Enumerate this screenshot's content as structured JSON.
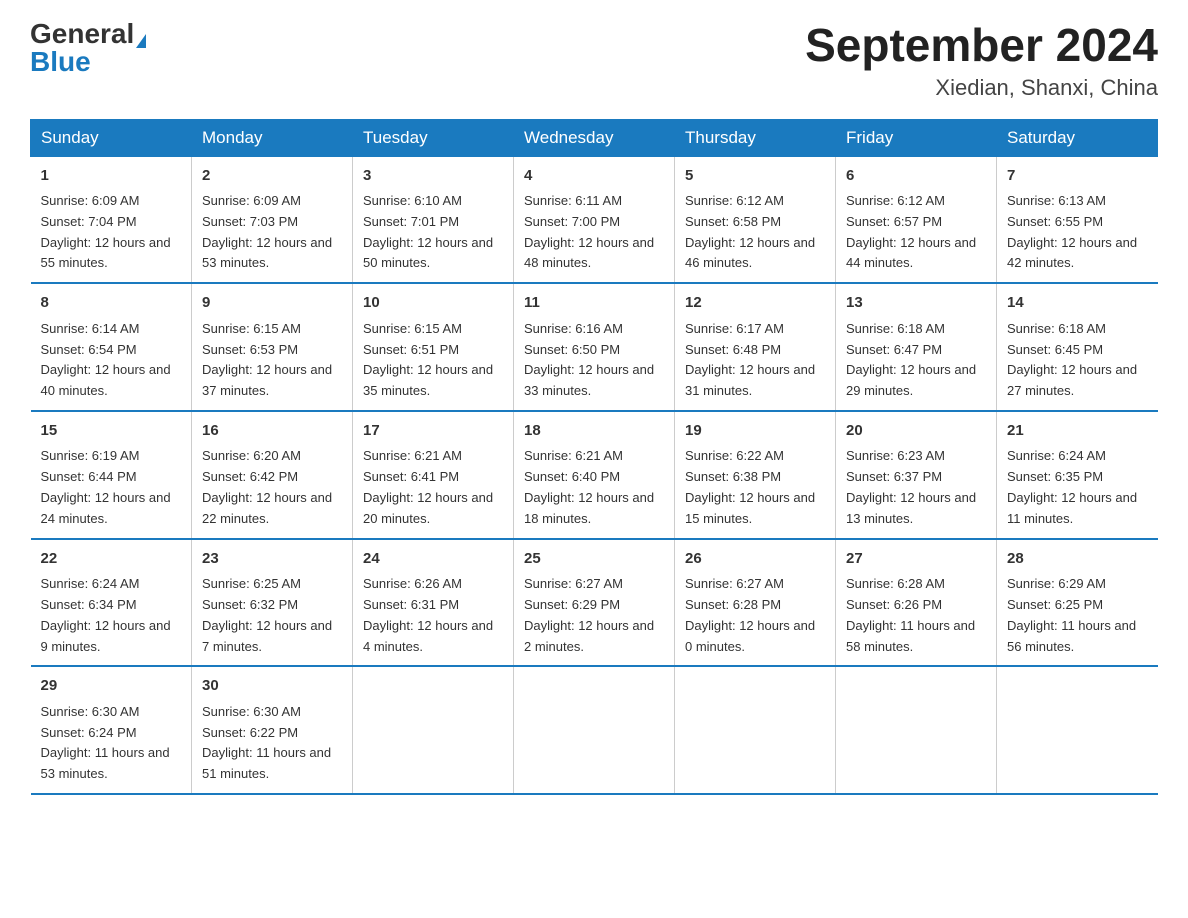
{
  "header": {
    "logo_general": "General",
    "logo_blue": "Blue",
    "month_year": "September 2024",
    "location": "Xiedian, Shanxi, China"
  },
  "weekdays": [
    "Sunday",
    "Monday",
    "Tuesday",
    "Wednesday",
    "Thursday",
    "Friday",
    "Saturday"
  ],
  "weeks": [
    [
      {
        "day": "1",
        "sunrise": "6:09 AM",
        "sunset": "7:04 PM",
        "daylight": "12 hours and 55 minutes."
      },
      {
        "day": "2",
        "sunrise": "6:09 AM",
        "sunset": "7:03 PM",
        "daylight": "12 hours and 53 minutes."
      },
      {
        "day": "3",
        "sunrise": "6:10 AM",
        "sunset": "7:01 PM",
        "daylight": "12 hours and 50 minutes."
      },
      {
        "day": "4",
        "sunrise": "6:11 AM",
        "sunset": "7:00 PM",
        "daylight": "12 hours and 48 minutes."
      },
      {
        "day": "5",
        "sunrise": "6:12 AM",
        "sunset": "6:58 PM",
        "daylight": "12 hours and 46 minutes."
      },
      {
        "day": "6",
        "sunrise": "6:12 AM",
        "sunset": "6:57 PM",
        "daylight": "12 hours and 44 minutes."
      },
      {
        "day": "7",
        "sunrise": "6:13 AM",
        "sunset": "6:55 PM",
        "daylight": "12 hours and 42 minutes."
      }
    ],
    [
      {
        "day": "8",
        "sunrise": "6:14 AM",
        "sunset": "6:54 PM",
        "daylight": "12 hours and 40 minutes."
      },
      {
        "day": "9",
        "sunrise": "6:15 AM",
        "sunset": "6:53 PM",
        "daylight": "12 hours and 37 minutes."
      },
      {
        "day": "10",
        "sunrise": "6:15 AM",
        "sunset": "6:51 PM",
        "daylight": "12 hours and 35 minutes."
      },
      {
        "day": "11",
        "sunrise": "6:16 AM",
        "sunset": "6:50 PM",
        "daylight": "12 hours and 33 minutes."
      },
      {
        "day": "12",
        "sunrise": "6:17 AM",
        "sunset": "6:48 PM",
        "daylight": "12 hours and 31 minutes."
      },
      {
        "day": "13",
        "sunrise": "6:18 AM",
        "sunset": "6:47 PM",
        "daylight": "12 hours and 29 minutes."
      },
      {
        "day": "14",
        "sunrise": "6:18 AM",
        "sunset": "6:45 PM",
        "daylight": "12 hours and 27 minutes."
      }
    ],
    [
      {
        "day": "15",
        "sunrise": "6:19 AM",
        "sunset": "6:44 PM",
        "daylight": "12 hours and 24 minutes."
      },
      {
        "day": "16",
        "sunrise": "6:20 AM",
        "sunset": "6:42 PM",
        "daylight": "12 hours and 22 minutes."
      },
      {
        "day": "17",
        "sunrise": "6:21 AM",
        "sunset": "6:41 PM",
        "daylight": "12 hours and 20 minutes."
      },
      {
        "day": "18",
        "sunrise": "6:21 AM",
        "sunset": "6:40 PM",
        "daylight": "12 hours and 18 minutes."
      },
      {
        "day": "19",
        "sunrise": "6:22 AM",
        "sunset": "6:38 PM",
        "daylight": "12 hours and 15 minutes."
      },
      {
        "day": "20",
        "sunrise": "6:23 AM",
        "sunset": "6:37 PM",
        "daylight": "12 hours and 13 minutes."
      },
      {
        "day": "21",
        "sunrise": "6:24 AM",
        "sunset": "6:35 PM",
        "daylight": "12 hours and 11 minutes."
      }
    ],
    [
      {
        "day": "22",
        "sunrise": "6:24 AM",
        "sunset": "6:34 PM",
        "daylight": "12 hours and 9 minutes."
      },
      {
        "day": "23",
        "sunrise": "6:25 AM",
        "sunset": "6:32 PM",
        "daylight": "12 hours and 7 minutes."
      },
      {
        "day": "24",
        "sunrise": "6:26 AM",
        "sunset": "6:31 PM",
        "daylight": "12 hours and 4 minutes."
      },
      {
        "day": "25",
        "sunrise": "6:27 AM",
        "sunset": "6:29 PM",
        "daylight": "12 hours and 2 minutes."
      },
      {
        "day": "26",
        "sunrise": "6:27 AM",
        "sunset": "6:28 PM",
        "daylight": "12 hours and 0 minutes."
      },
      {
        "day": "27",
        "sunrise": "6:28 AM",
        "sunset": "6:26 PM",
        "daylight": "11 hours and 58 minutes."
      },
      {
        "day": "28",
        "sunrise": "6:29 AM",
        "sunset": "6:25 PM",
        "daylight": "11 hours and 56 minutes."
      }
    ],
    [
      {
        "day": "29",
        "sunrise": "6:30 AM",
        "sunset": "6:24 PM",
        "daylight": "11 hours and 53 minutes."
      },
      {
        "day": "30",
        "sunrise": "6:30 AM",
        "sunset": "6:22 PM",
        "daylight": "11 hours and 51 minutes."
      },
      null,
      null,
      null,
      null,
      null
    ]
  ]
}
